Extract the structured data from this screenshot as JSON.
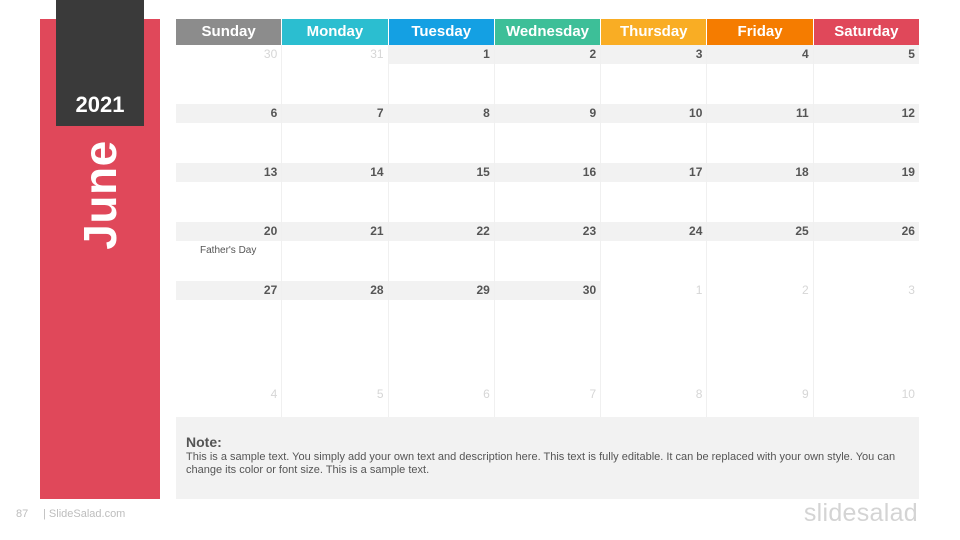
{
  "sidebar": {
    "year": "2021",
    "month": "June",
    "accent_color": "#e0485a",
    "tab_color": "#3a3a3a"
  },
  "calendar": {
    "headers": [
      {
        "label": "Sunday",
        "color": "#8c8c8c"
      },
      {
        "label": "Monday",
        "color": "#2bbed0"
      },
      {
        "label": "Tuesday",
        "color": "#14a0e3"
      },
      {
        "label": "Wednesday",
        "color": "#3dbf98"
      },
      {
        "label": "Thursday",
        "color": "#f9ad24"
      },
      {
        "label": "Friday",
        "color": "#f57c00"
      },
      {
        "label": "Saturday",
        "color": "#e0485a"
      }
    ],
    "weeks": [
      [
        {
          "day": "30",
          "in_month": false,
          "highlight": false
        },
        {
          "day": "31",
          "in_month": false,
          "highlight": false
        },
        {
          "day": "1",
          "in_month": true
        },
        {
          "day": "2",
          "in_month": true
        },
        {
          "day": "3",
          "in_month": true
        },
        {
          "day": "4",
          "in_month": true
        },
        {
          "day": "5",
          "in_month": true
        }
      ],
      [
        {
          "day": "6",
          "in_month": true
        },
        {
          "day": "7",
          "in_month": true
        },
        {
          "day": "8",
          "in_month": true
        },
        {
          "day": "9",
          "in_month": true
        },
        {
          "day": "10",
          "in_month": true
        },
        {
          "day": "11",
          "in_month": true
        },
        {
          "day": "12",
          "in_month": true
        }
      ],
      [
        {
          "day": "13",
          "in_month": true
        },
        {
          "day": "14",
          "in_month": true
        },
        {
          "day": "15",
          "in_month": true
        },
        {
          "day": "16",
          "in_month": true
        },
        {
          "day": "17",
          "in_month": true
        },
        {
          "day": "18",
          "in_month": true
        },
        {
          "day": "19",
          "in_month": true
        }
      ],
      [
        {
          "day": "20",
          "in_month": true,
          "event": "Father's Day"
        },
        {
          "day": "21",
          "in_month": true
        },
        {
          "day": "22",
          "in_month": true
        },
        {
          "day": "23",
          "in_month": true
        },
        {
          "day": "24",
          "in_month": true
        },
        {
          "day": "25",
          "in_month": true
        },
        {
          "day": "26",
          "in_month": true
        }
      ],
      [
        {
          "day": "27",
          "in_month": true
        },
        {
          "day": "28",
          "in_month": true
        },
        {
          "day": "29",
          "in_month": true
        },
        {
          "day": "30",
          "in_month": true
        },
        {
          "day": "1",
          "in_month": false
        },
        {
          "day": "2",
          "in_month": false
        },
        {
          "day": "3",
          "in_month": false
        }
      ],
      [
        {
          "day": "4",
          "in_month": false
        },
        {
          "day": "5",
          "in_month": false
        },
        {
          "day": "6",
          "in_month": false
        },
        {
          "day": "7",
          "in_month": false
        },
        {
          "day": "8",
          "in_month": false
        },
        {
          "day": "9",
          "in_month": false
        },
        {
          "day": "10",
          "in_month": false
        }
      ]
    ]
  },
  "note": {
    "title": "Note:",
    "body": "This is a sample text. You simply add your own text and description here. This text is fully editable. It can be replaced with your own style. You can change its color or font size. This is a sample text."
  },
  "footer": {
    "page_number": "87",
    "site": "| SlideSalad.com",
    "brand": "slidesalad"
  }
}
